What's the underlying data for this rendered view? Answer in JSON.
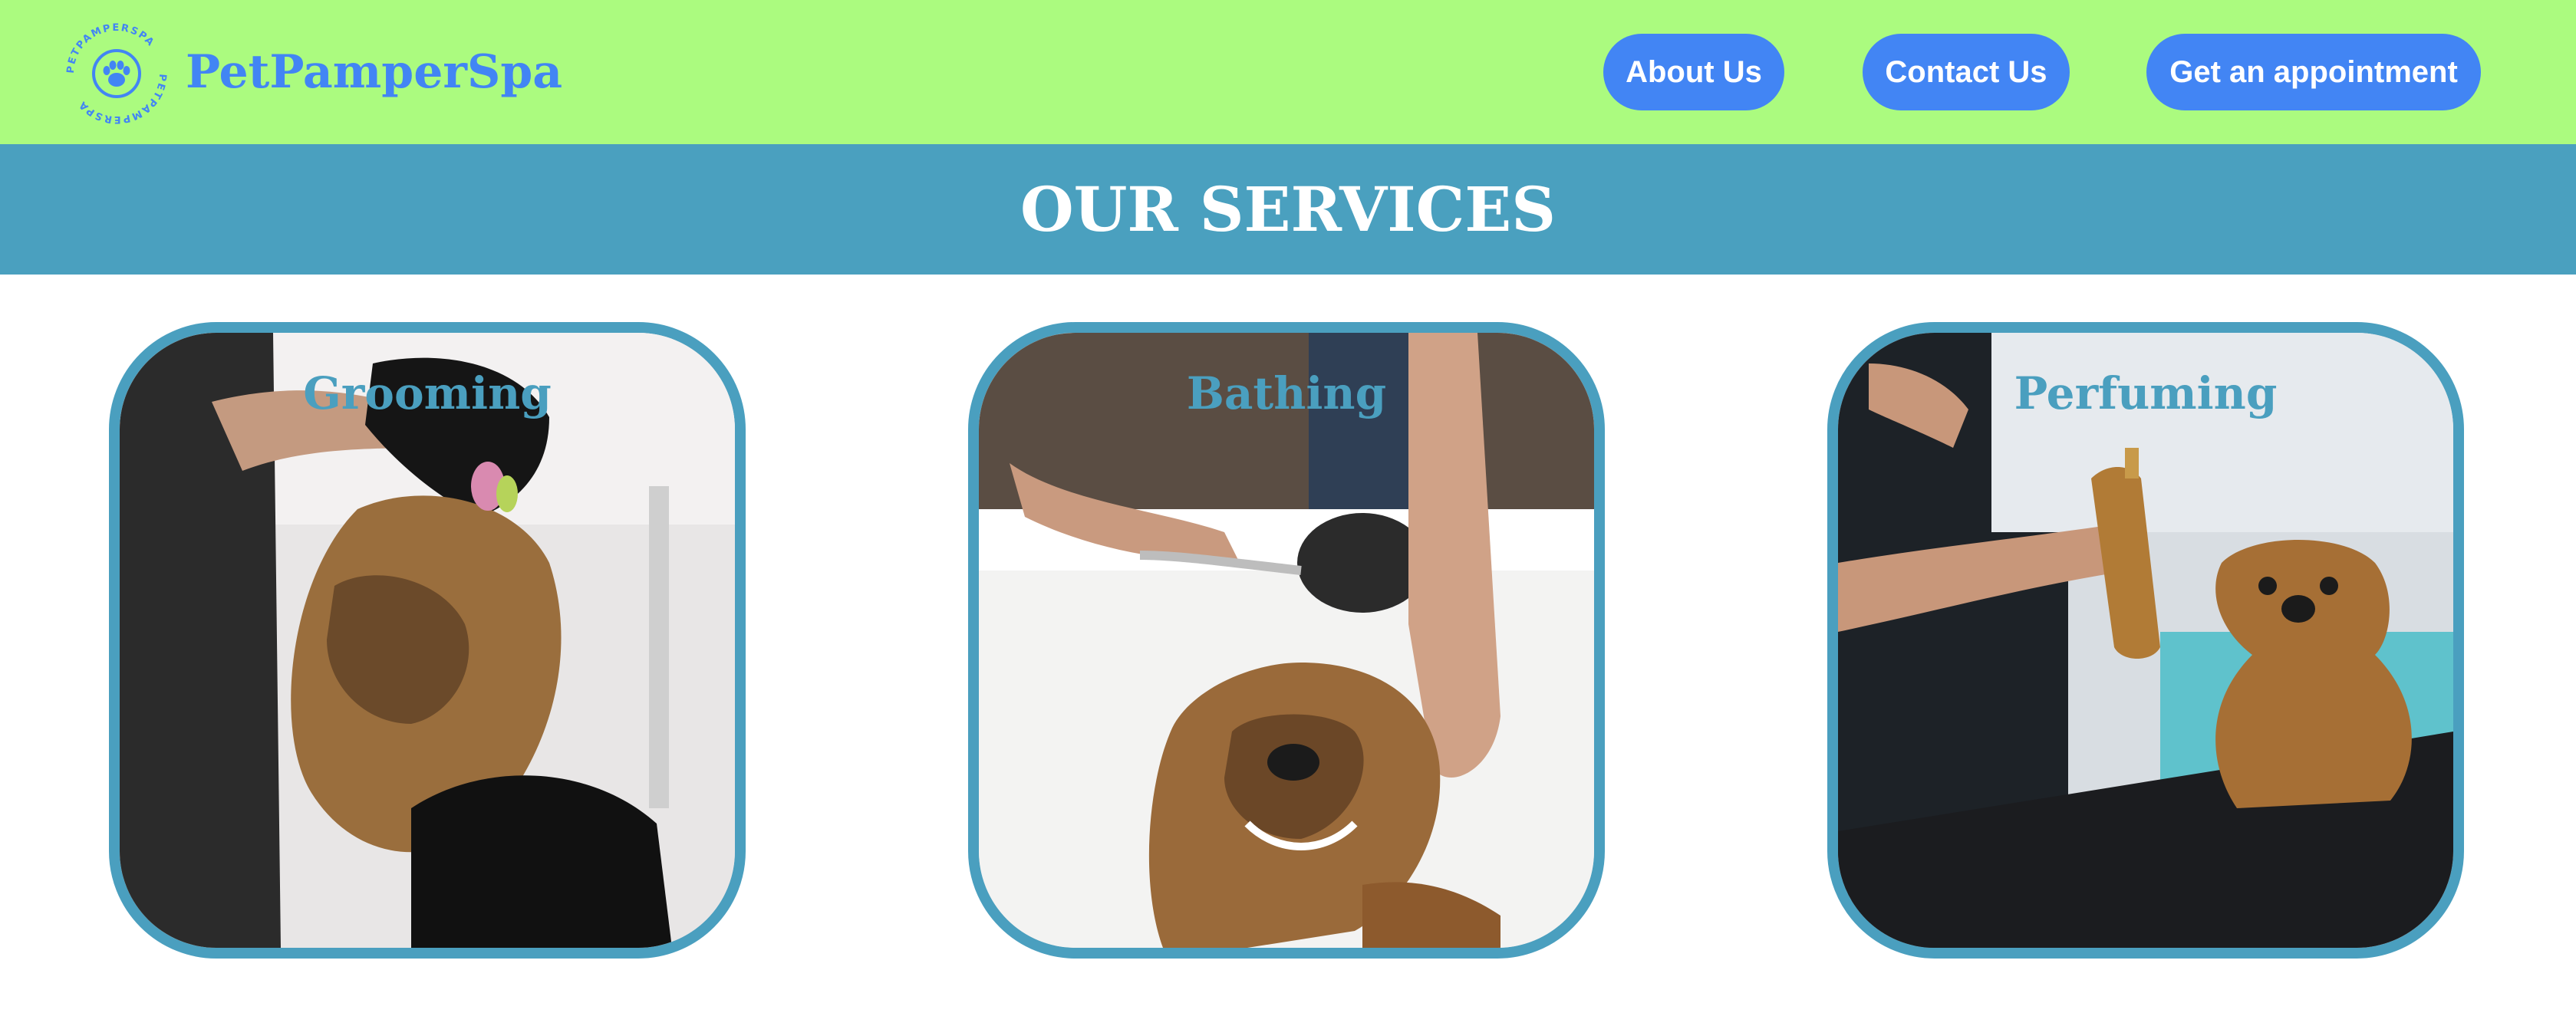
{
  "header": {
    "brand": "PetPamperSpa",
    "logo_ring_text": "PETPAMPERSPA",
    "logo_icon": "paw-icon",
    "nav": [
      {
        "label": "About Us"
      },
      {
        "label": "Contact Us"
      },
      {
        "label": "Get an appointment"
      }
    ]
  },
  "services": {
    "title": "OUR SERVICES",
    "cards": [
      {
        "title": "Grooming",
        "image": "dog-grooming-photo"
      },
      {
        "title": "Bathing",
        "image": "dog-bathing-photo"
      },
      {
        "title": "Perfuming",
        "image": "dog-perfuming-photo"
      }
    ]
  },
  "colors": {
    "header_bg": "#abfb7f",
    "brand_blue": "#4285f4",
    "band_bg": "#4aa0bf",
    "card_border": "#4a9fbf",
    "white": "#ffffff"
  }
}
